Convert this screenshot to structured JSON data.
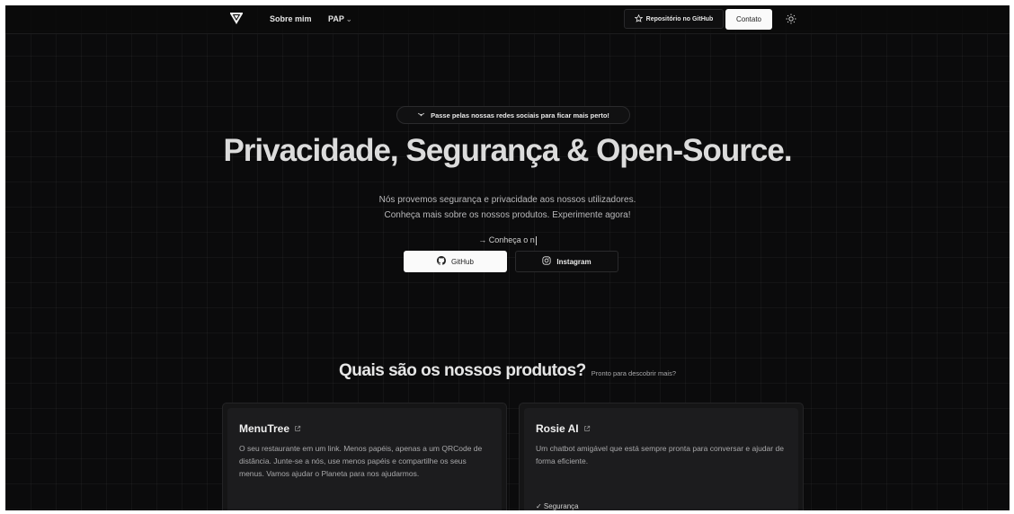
{
  "nav": {
    "sobre_label": "Sobre mim",
    "pap_label": "PAP",
    "repo_label": "Repositório no GitHub",
    "contato_label": "Contato"
  },
  "hero": {
    "pill_text": "Passe pelas nossas redes sociais para ficar mais perto!",
    "title": "Privacidade, Segurança & Open-Source.",
    "subtitle_line1": "Nós provemos segurança e privacidade aos nossos utilizadores.",
    "subtitle_line2": "Conheça mais sobre os nossos produtos. Experimente agora!",
    "typing_text": "→ Conheça o n",
    "github_label": "GitHub",
    "instagram_label": "Instagram"
  },
  "products": {
    "heading": "Quais são os nossos produtos?",
    "subheading": "Pronto para descobrir mais?",
    "cards": [
      {
        "title": "MenuTree",
        "description": "O seu restaurante em um link. Menos papéis, apenas a um QRCode de distância. Junte-se a nós, use menos papéis e compartilhe os seus menus. Vamos ajudar o Planeta para nos ajudarmos."
      },
      {
        "title": "Rosie AI",
        "description": "Um chatbot amigável que está sempre pronta para conversar e ajudar de forma eficiente.",
        "feature": "✓ Segurança"
      }
    ]
  },
  "colors": {
    "background": "#0b0b0c",
    "primary_button": "#fafafa",
    "card": "#1c1c1e"
  }
}
